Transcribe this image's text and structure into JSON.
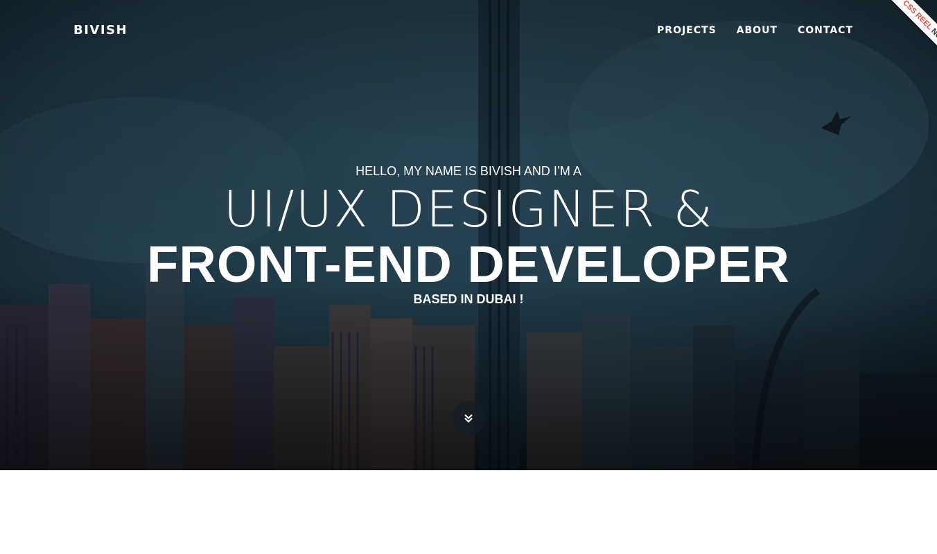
{
  "brand": {
    "name": "BIVISH"
  },
  "nav": {
    "items": [
      {
        "label": "PROJECTS"
      },
      {
        "label": "ABOUT"
      },
      {
        "label": "CONTACT"
      }
    ]
  },
  "ribbon": {
    "text_highlight": "CSS REEL",
    "text_rest": "NOMINEE",
    "highlight_color": "#e0503a"
  },
  "hero": {
    "intro": "HELLO, MY NAME IS BIVISH AND I’M A",
    "title_light": "UI/UX DESIGNER &",
    "title_bold": "FRONT-END DEVELOPER",
    "location": "BASED IN DUBAI !",
    "scroll_icon": "double-chevron-down-icon",
    "background_color": "#1c3240",
    "accent_color": "#ffffff"
  }
}
